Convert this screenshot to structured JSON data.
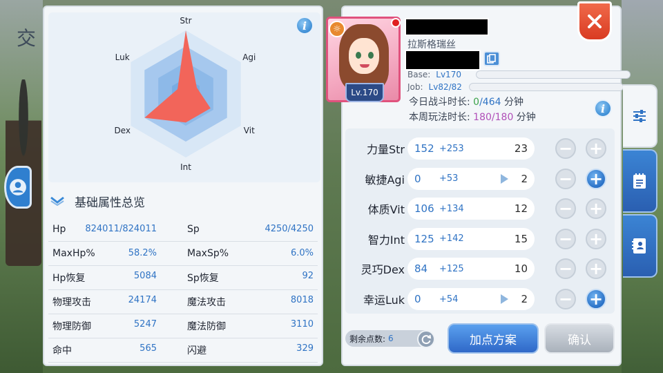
{
  "background": {
    "glyph": "交"
  },
  "radar": {
    "labels": [
      "Str",
      "Agi",
      "Vit",
      "Int",
      "Dex",
      "Luk"
    ],
    "values": [
      1.0,
      0.2,
      0.45,
      0.45,
      0.75,
      0.15
    ],
    "colors": {
      "fill": "#f2655a",
      "grid": "#a6c8ee",
      "axis": "#dbe7f5"
    }
  },
  "summary": {
    "title": "基础属性总览",
    "rows": [
      {
        "k1": "Hp",
        "v1": "824011/824011",
        "k2": "Sp",
        "v2": "4250/4250"
      },
      {
        "k1": "MaxHp%",
        "v1": "58.2%",
        "k2": "MaxSp%",
        "v2": "6.0%"
      },
      {
        "k1": "Hp恢复",
        "v1": "5084",
        "k2": "Sp恢复",
        "v2": "92"
      },
      {
        "k1": "物理攻击",
        "v1": "24174",
        "k2": "魔法攻击",
        "v2": "8018"
      },
      {
        "k1": "物理防御",
        "v1": "5247",
        "k2": "魔法防御",
        "v2": "3110"
      },
      {
        "k1": "命中",
        "v1": "565",
        "k2": "闪避",
        "v2": "329"
      }
    ]
  },
  "profile": {
    "name": "拉斯格瑞丝",
    "portrait_level": "Lv.170",
    "base_label": "Base:",
    "base_value": "Lv170",
    "job_label": "Job:",
    "job_value": "Lv82/82",
    "today_label": "今日战斗时长:",
    "today_cur": "0",
    "today_max": "/464",
    "today_unit": " 分钟",
    "week_label": "本周玩法时长:",
    "week_cur": "180",
    "week_max": "/180",
    "week_unit": " 分钟"
  },
  "attributes": [
    {
      "name": "力量Str",
      "base": "152",
      "bonus": "+253",
      "cost": "23",
      "arrow": false,
      "plus_enabled": false
    },
    {
      "name": "敏捷Agi",
      "base": "0",
      "bonus": "+53",
      "cost": "2",
      "arrow": true,
      "plus_enabled": true
    },
    {
      "name": "体质Vit",
      "base": "106",
      "bonus": "+134",
      "cost": "12",
      "arrow": false,
      "plus_enabled": false
    },
    {
      "name": "智力Int",
      "base": "125",
      "bonus": "+142",
      "cost": "15",
      "arrow": false,
      "plus_enabled": false
    },
    {
      "name": "灵巧Dex",
      "base": "84",
      "bonus": "+125",
      "cost": "10",
      "arrow": false,
      "plus_enabled": false
    },
    {
      "name": "幸运Luk",
      "base": "0",
      "bonus": "+54",
      "cost": "2",
      "arrow": true,
      "plus_enabled": true
    }
  ],
  "footer": {
    "remain_label": "剩余点数:",
    "remain_value": "6",
    "plan_label": "加点方案",
    "confirm_label": "确认"
  },
  "icons": {
    "info": "i",
    "close": "close-icon",
    "tabs": [
      "sliders-icon",
      "notepad-icon",
      "contact-book-icon"
    ]
  }
}
